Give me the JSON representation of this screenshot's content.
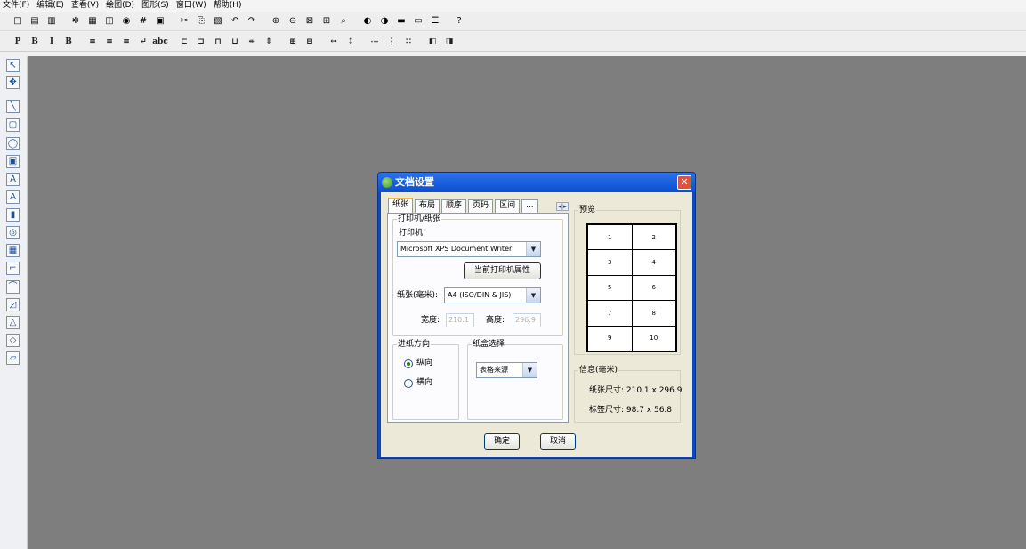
{
  "menu": [
    "文件(F)",
    "编辑(E)",
    "查看(V)",
    "绘图(D)",
    "图形(S)",
    "窗口(W)",
    "帮助(H)"
  ],
  "toolbar1": [
    {
      "icon": "new-icon",
      "glyph": "□"
    },
    {
      "icon": "open-icon",
      "glyph": "▤"
    },
    {
      "icon": "save-icon",
      "glyph": "▥"
    },
    {
      "icon": "settings-icon",
      "glyph": "✲"
    },
    {
      "icon": "print-icon",
      "glyph": "▦"
    },
    {
      "icon": "print-preview-icon",
      "glyph": "◫"
    },
    {
      "icon": "database-icon",
      "glyph": "◉"
    },
    {
      "icon": "grid-icon",
      "glyph": "#"
    },
    {
      "icon": "calculator-icon",
      "glyph": "▣"
    },
    {
      "icon": "cut-icon",
      "glyph": "✂"
    },
    {
      "icon": "copy-icon",
      "glyph": "⎘"
    },
    {
      "icon": "paste-icon",
      "glyph": "▧"
    },
    {
      "icon": "undo-icon",
      "glyph": "↶"
    },
    {
      "icon": "redo-icon",
      "glyph": "↷"
    },
    {
      "icon": "zoom-in-icon",
      "glyph": "⊕"
    },
    {
      "icon": "zoom-out-icon",
      "glyph": "⊖"
    },
    {
      "icon": "fit-page-icon",
      "glyph": "⊠"
    },
    {
      "icon": "fit-width-icon",
      "glyph": "⊞"
    },
    {
      "icon": "zoom-icon",
      "glyph": "⌕"
    },
    {
      "icon": "show-icon",
      "glyph": "◐"
    },
    {
      "icon": "hide-icon",
      "glyph": "◑"
    },
    {
      "icon": "color-icon",
      "glyph": "▬"
    },
    {
      "icon": "fill-icon",
      "glyph": "▭"
    },
    {
      "icon": "list-icon",
      "glyph": "☰"
    },
    {
      "icon": "help-icon",
      "glyph": "?"
    }
  ],
  "toolbar2": [
    {
      "icon": "plain-text-icon",
      "glyph": "P"
    },
    {
      "icon": "bold-icon",
      "glyph": "B"
    },
    {
      "icon": "italic-icon",
      "glyph": "I"
    },
    {
      "icon": "bold-italic-icon",
      "glyph": "B"
    },
    {
      "icon": "align-left-icon",
      "glyph": "≡"
    },
    {
      "icon": "align-center-icon",
      "glyph": "≡"
    },
    {
      "icon": "align-right-icon",
      "glyph": "≡"
    },
    {
      "icon": "text-wrap-icon",
      "glyph": "↵"
    },
    {
      "icon": "abc-icon",
      "glyph": "abc"
    },
    {
      "icon": "align-objects-left-icon",
      "glyph": "⊏"
    },
    {
      "icon": "align-objects-right-icon",
      "glyph": "⊐"
    },
    {
      "icon": "align-top-icon",
      "glyph": "⊓"
    },
    {
      "icon": "align-bottom-icon",
      "glyph": "⊔"
    },
    {
      "icon": "distribute-h-icon",
      "glyph": "⇹"
    },
    {
      "icon": "distribute-v-icon",
      "glyph": "⇕"
    },
    {
      "icon": "center-h-icon",
      "glyph": "⊞"
    },
    {
      "icon": "center-v-icon",
      "glyph": "⊟"
    },
    {
      "icon": "same-width-icon",
      "glyph": "↔"
    },
    {
      "icon": "same-height-icon",
      "glyph": "↕"
    },
    {
      "icon": "spacing-h-icon",
      "glyph": "⋯"
    },
    {
      "icon": "spacing-v-icon",
      "glyph": "⋮"
    },
    {
      "icon": "spacing-equal-icon",
      "glyph": "∷"
    },
    {
      "icon": "bring-front-icon",
      "glyph": "◧"
    },
    {
      "icon": "send-back-icon",
      "glyph": "◨"
    }
  ],
  "palette": [
    {
      "icon": "select-pointer-icon",
      "glyph": "↖"
    },
    {
      "icon": "pan-icon",
      "glyph": "✥"
    },
    {
      "icon": "line-icon",
      "glyph": "╲"
    },
    {
      "icon": "rectangle-icon",
      "glyph": "▢"
    },
    {
      "icon": "ellipse-icon",
      "glyph": "◯"
    },
    {
      "icon": "image-icon",
      "glyph": "▣"
    },
    {
      "icon": "text-icon",
      "glyph": "A"
    },
    {
      "icon": "outline-text-icon",
      "glyph": "A"
    },
    {
      "icon": "barcode-icon",
      "glyph": "▮"
    },
    {
      "icon": "seal-icon",
      "glyph": "◎"
    },
    {
      "icon": "table-icon",
      "glyph": "▦"
    },
    {
      "icon": "polyline-icon",
      "glyph": "⌐"
    },
    {
      "icon": "arc-icon",
      "glyph": "⌒"
    },
    {
      "icon": "polygon-icon",
      "glyph": "◿"
    },
    {
      "icon": "triangle-icon",
      "glyph": "△"
    },
    {
      "icon": "diamond-icon",
      "glyph": "◇"
    },
    {
      "icon": "parallelogram-icon",
      "glyph": "▱"
    }
  ],
  "dialog": {
    "title": "文档设置",
    "close_glyph": "✕",
    "tabs": [
      "纸张",
      "布局",
      "顺序",
      "页码",
      "区间",
      "..."
    ],
    "tab_scroll": "◂|▸",
    "printer_group": "打印机/纸张",
    "printer_label": "打印机:",
    "printer_value": "Microsoft XPS Document Writer",
    "printer_props_button": "当前打印机属性",
    "paper_label": "纸张(毫米):",
    "paper_value": "A4 (ISO/DIN & JIS)",
    "width_label": "宽度:",
    "width_value": "210.1",
    "height_label": "高度:",
    "height_value": "296.9",
    "orientation_group": "进纸方向",
    "portrait_label": "纵向",
    "landscape_label": "横向",
    "portrait_selected": true,
    "tray_group": "纸盒选择",
    "tray_value": "表格来源",
    "preview_group": "预览",
    "preview_cells": [
      "1",
      "2",
      "3",
      "4",
      "5",
      "6",
      "7",
      "8",
      "9",
      "10"
    ],
    "info_group": "信息(毫米)",
    "paper_size_text": "纸张尺寸: 210.1 x 296.9",
    "label_size_text": "标签尺寸: 98.7 x 56.8",
    "ok_button": "确定",
    "cancel_button": "取消",
    "dropdown_arrow": "▼"
  }
}
